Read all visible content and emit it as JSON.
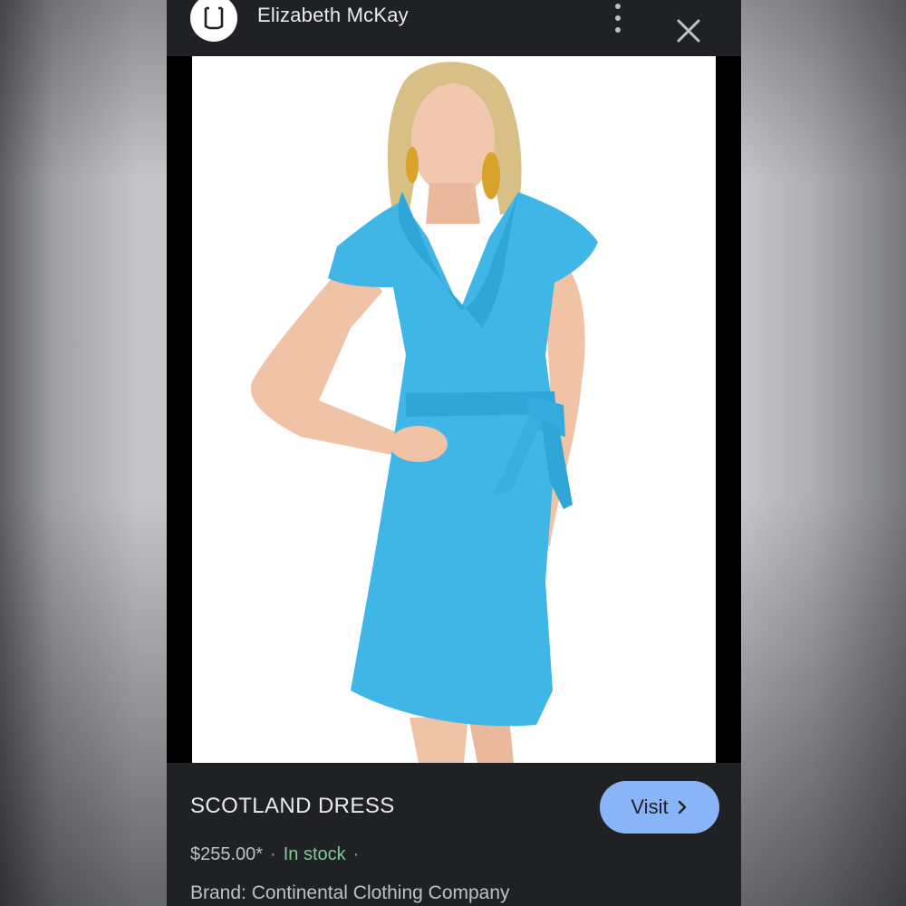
{
  "header": {
    "site_name": "Elizabeth McKay",
    "logo_icon": "brand-logo-icon",
    "more_icon": "more-vert-icon",
    "close_icon": "close-icon"
  },
  "image": {
    "subject": "product-photo"
  },
  "product": {
    "title": "SCOTLAND DRESS",
    "price": "$255.00*",
    "separator": "·",
    "stock": "In stock",
    "trailing_separator": "·",
    "brand": "Brand: Continental Clothing Company"
  },
  "actions": {
    "visit_label": "Visit",
    "visit_icon": "chevron-right-icon"
  },
  "colors": {
    "panel_bg": "#202124",
    "visit_bg": "#8ab4f8",
    "stock_green": "#81c995",
    "dress_blue": "#3fb6e6"
  }
}
